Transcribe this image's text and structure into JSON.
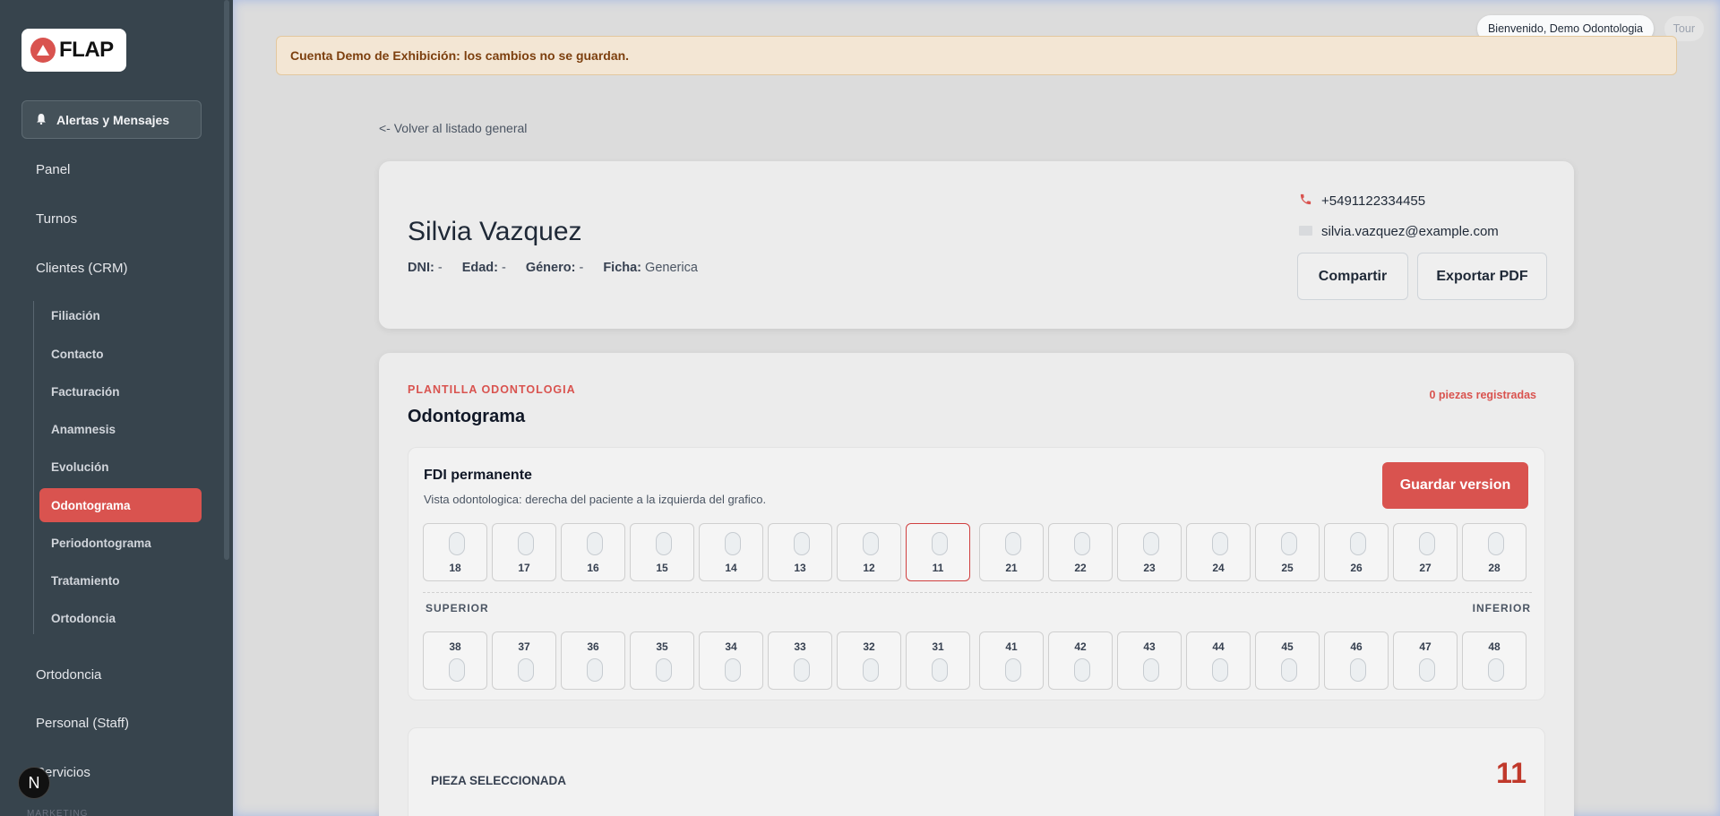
{
  "sidebar": {
    "logo_text": "FLAP",
    "alerts_label": "Alertas y Mensajes",
    "items": [
      {
        "label": "Panel"
      },
      {
        "label": "Turnos"
      },
      {
        "label": "Clientes (CRM)"
      },
      {
        "label": "Ortodoncia"
      },
      {
        "label": "Personal (Staff)"
      },
      {
        "label": "Servicios"
      }
    ],
    "sub_items": [
      {
        "label": "Filiación"
      },
      {
        "label": "Contacto"
      },
      {
        "label": "Facturación"
      },
      {
        "label": "Anamnesis"
      },
      {
        "label": "Evolución"
      },
      {
        "label": "Odontograma",
        "active": true
      },
      {
        "label": "Periodontograma"
      },
      {
        "label": "Tratamiento"
      },
      {
        "label": "Ortodoncia"
      }
    ],
    "section_label": "MARKETING",
    "badge": "N"
  },
  "topbar": {
    "welcome": "Bienvenido, Demo Odontologia",
    "tour": "Tour"
  },
  "banner": "Cuenta Demo de Exhibición: los cambios no se guardan.",
  "back_link": "<- Volver al listado general",
  "patient": {
    "name": "Silvia Vazquez",
    "dni_label": "DNI:",
    "dni": "-",
    "age_label": "Edad:",
    "age": "-",
    "gender_label": "Género:",
    "gender": "-",
    "ficha_label": "Ficha:",
    "ficha": "Generica",
    "phone": "+5491122334455",
    "email": "silvia.vazquez@example.com",
    "share_label": "Compartir",
    "pdf_label": "Exportar PDF"
  },
  "odontogram": {
    "template_label": "PLANTILLA ODONTOLOGIA",
    "title": "Odontograma",
    "pieces_count": "0 piezas registradas",
    "fdi_title": "FDI permanente",
    "fdi_subtitle": "Vista odontologica: derecha del paciente a la izquierda del grafico.",
    "save_label": "Guardar version",
    "upper_teeth": [
      "18",
      "17",
      "16",
      "15",
      "14",
      "13",
      "12",
      "11",
      "21",
      "22",
      "23",
      "24",
      "25",
      "26",
      "27",
      "28"
    ],
    "lower_teeth": [
      "38",
      "37",
      "36",
      "35",
      "34",
      "33",
      "32",
      "31",
      "41",
      "42",
      "43",
      "44",
      "45",
      "46",
      "47",
      "48"
    ],
    "selected_tooth": "11",
    "jaw_upper": "SUPERIOR",
    "jaw_lower": "INFERIOR",
    "selected_label": "PIEZA SELECCIONADA",
    "selected_value": "11"
  },
  "colors": {
    "accent": "#d9534f",
    "sidebar_bg": "#37444d",
    "banner_bg": "#f3e6d4"
  }
}
